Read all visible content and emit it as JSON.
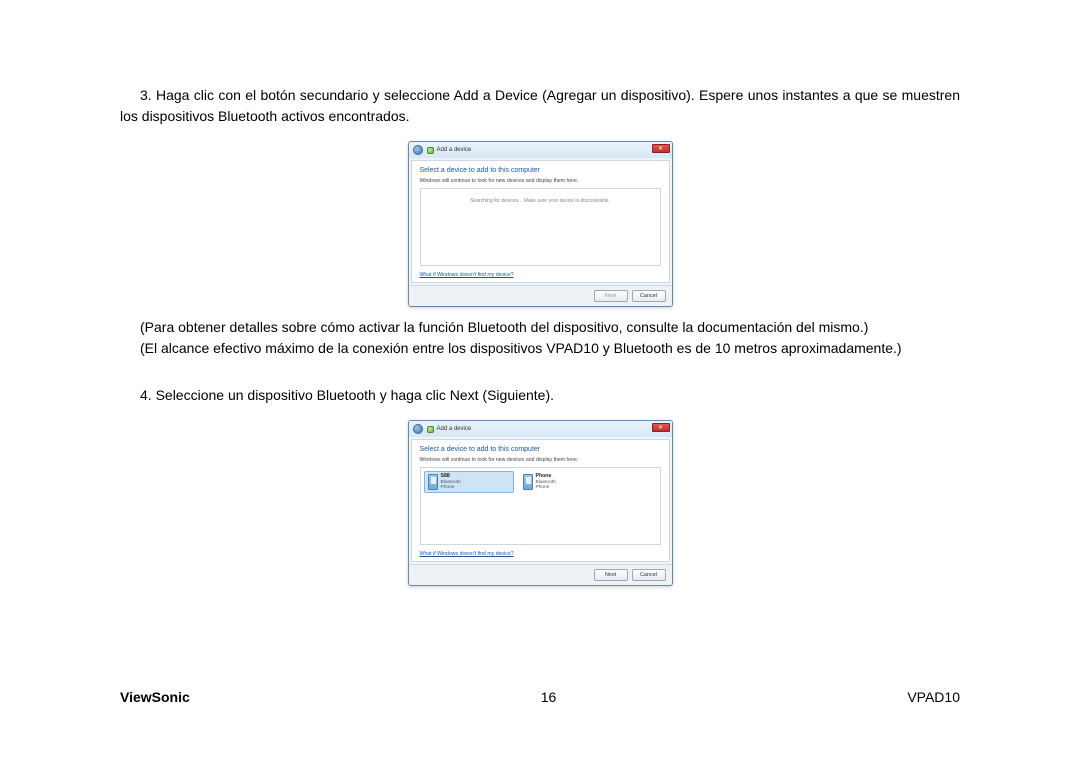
{
  "step3": {
    "text": "3. Haga clic con el botón secundario y seleccione Add a Device (Agregar un dispositivo). Espere unos instantes a que se muestren los dispositivos Bluetooth activos encontrados."
  },
  "dialog1": {
    "title": "Add a device",
    "heading": "Select a device to add to this computer",
    "subtext": "Windows will continue to look for new devices and display them here.",
    "searching": "Searching for devices... Make sure your device is discoverable.",
    "help_link": "What if Windows doesn't find my device?",
    "next_btn": "Next",
    "cancel_btn": "Cancel"
  },
  "notes": {
    "n1": "(Para obtener detalles sobre cómo activar la función Bluetooth del dispositivo, consulte la documentación del mismo.)",
    "n2": "(El alcance efectivo máximo de la conexión entre los dispositivos VPAD10 y Bluetooth es de 10 metros aproximadamente.)"
  },
  "step4": {
    "text": "4. Seleccione un dispositivo Bluetooth y haga clic Next (Siguiente)."
  },
  "dialog2": {
    "title": "Add a device",
    "heading": "Select a device to add to this computer",
    "subtext": "Windows will continue to look for new devices and display them here.",
    "devices": [
      {
        "name": "S88",
        "proto": "Bluetooth",
        "type": "Phone",
        "selected": true
      },
      {
        "name": "Phone",
        "proto": "Bluetooth",
        "type": "Phone",
        "selected": false
      }
    ],
    "help_link": "What if Windows doesn't find my device?",
    "next_btn": "Next",
    "cancel_btn": "Cancel"
  },
  "footer": {
    "brand": "ViewSonic",
    "page": "16",
    "model": "VPAD10"
  }
}
